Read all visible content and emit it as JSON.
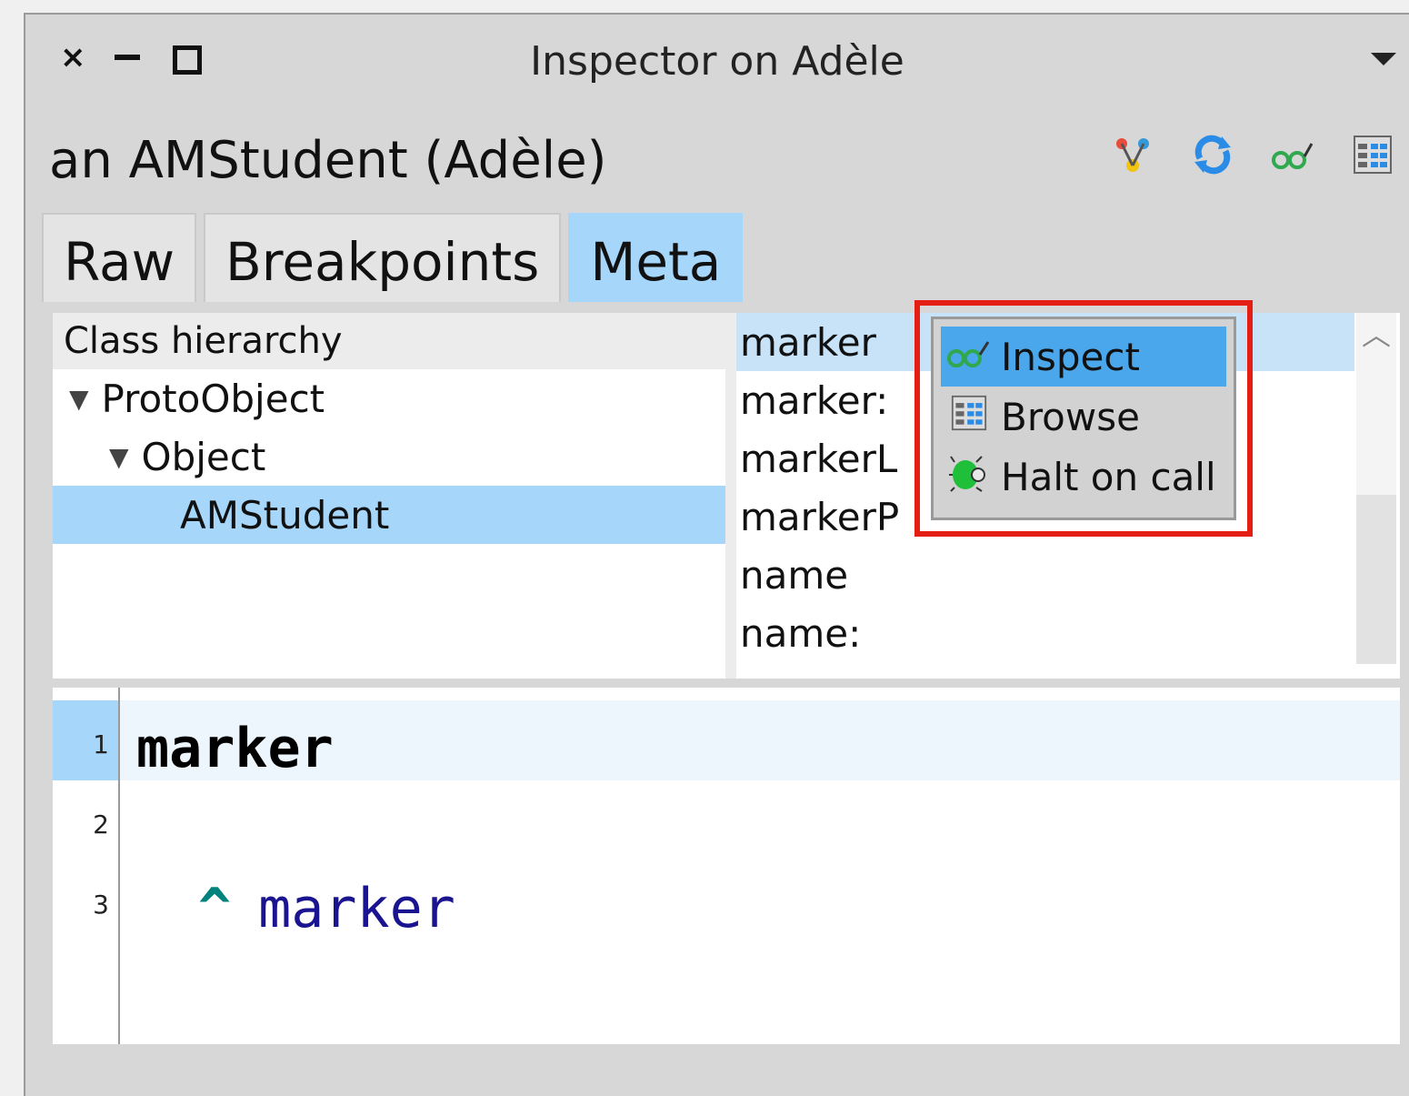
{
  "window": {
    "title": "Inspector on Adèle",
    "controls": {
      "close": "×",
      "minimize": "minimize",
      "maximize": "maximize"
    }
  },
  "header": {
    "object_title": "an AMStudent (Adèle)",
    "toolbar_icons": [
      "hierarchy-icon",
      "refresh-icon",
      "inspect-glasses-icon",
      "browse-icon"
    ]
  },
  "tabs": [
    {
      "label": "Raw",
      "active": false
    },
    {
      "label": "Breakpoints",
      "active": false
    },
    {
      "label": "Meta",
      "active": true
    }
  ],
  "hierarchy": {
    "header": "Class hierarchy",
    "items": [
      {
        "label": "ProtoObject",
        "expanded": true,
        "selected": false
      },
      {
        "label": "Object",
        "expanded": true,
        "selected": false
      },
      {
        "label": "AMStudent",
        "expanded": false,
        "selected": true
      }
    ]
  },
  "methods": [
    "marker",
    "marker:",
    "markerL",
    "markerP",
    "name",
    "name:"
  ],
  "context_menu": {
    "items": [
      {
        "label": "Inspect",
        "icon": "glasses-icon",
        "selected": true
      },
      {
        "label": "Browse",
        "icon": "browse-icon",
        "selected": false
      },
      {
        "label": "Halt on call",
        "icon": "bug-icon",
        "selected": false
      }
    ]
  },
  "editor": {
    "line_numbers": [
      "1",
      "2",
      "3"
    ],
    "line1": "marker",
    "line3_caret": "^",
    "line3_ident": "marker"
  },
  "colors": {
    "selection": "#a7d6fb",
    "menu_selection": "#4aa7ec",
    "highlight_frame": "#e51e14"
  }
}
